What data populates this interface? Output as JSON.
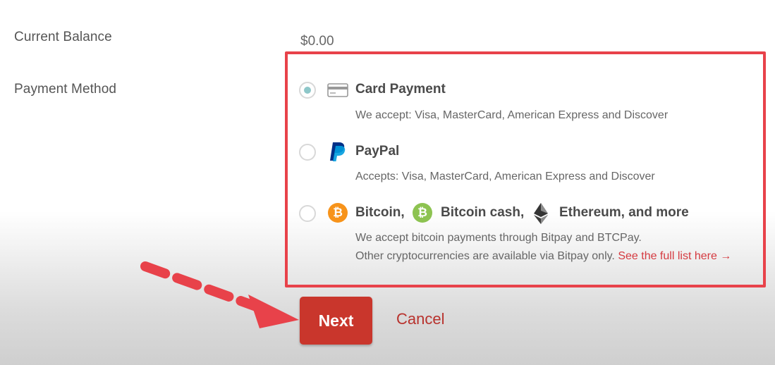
{
  "form": {
    "balance_label": "Current Balance",
    "balance_value": "$0.00",
    "payment_label": "Payment Method"
  },
  "payment_options": [
    {
      "title": "Card Payment",
      "desc": "We accept: Visa, MasterCard, American Express and Discover",
      "selected": true,
      "icon": "credit-card-icon"
    },
    {
      "title": "PayPal",
      "desc": "Accepts: Visa, MasterCard, American Express and Discover",
      "selected": false,
      "icon": "paypal-icon"
    },
    {
      "title_bitcoin": "Bitcoin,",
      "title_bitcoin_cash": "Bitcoin cash,",
      "title_ethereum": "Ethereum, and more",
      "desc_line1": "We accept bitcoin payments through Bitpay and BTCPay.",
      "desc_line2": "Other cryptocurrencies are available via Bitpay only.",
      "link": "See the full list here →",
      "selected": false,
      "icons": [
        "bitcoin-icon",
        "bitcoin-cash-icon",
        "ethereum-icon"
      ]
    }
  ],
  "actions": {
    "next_label": "Next",
    "cancel_label": "Cancel"
  },
  "colors": {
    "highlight": "#e8424a",
    "primary_button": "#c9362c",
    "radio_selected": "#8ec7c9",
    "bitcoin": "#f7931a",
    "bitcoin_cash": "#8dc351",
    "paypal_dark": "#003087",
    "paypal_light": "#009cde"
  },
  "annotation": {
    "arrow_icon": "dashed-arrow-icon"
  }
}
